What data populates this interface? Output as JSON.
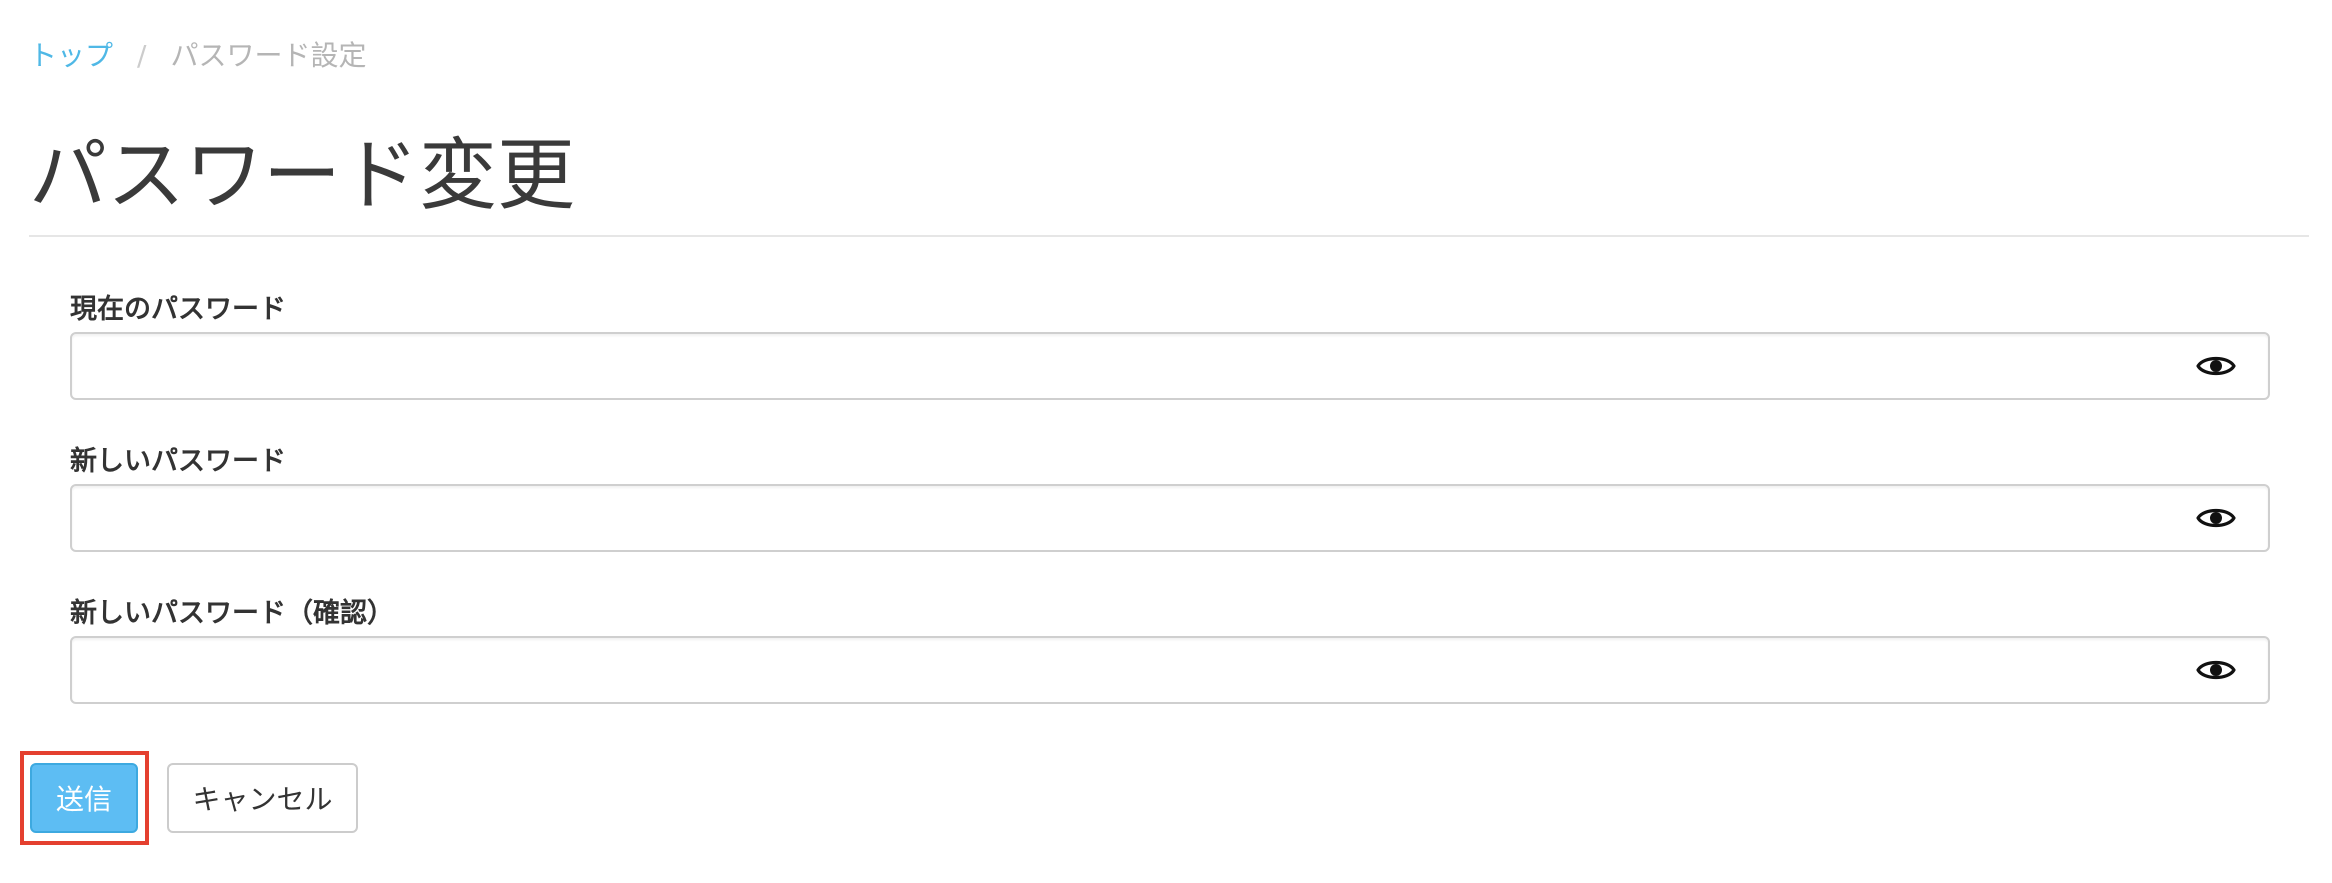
{
  "breadcrumb": {
    "items": [
      {
        "label": "トップ",
        "link": true
      },
      {
        "label": "パスワード設定",
        "link": false
      }
    ],
    "separator": "/"
  },
  "page": {
    "title": "パスワード変更"
  },
  "form": {
    "fields": [
      {
        "label": "現在のパスワード",
        "value": "",
        "icon": "eye-icon"
      },
      {
        "label": "新しいパスワード",
        "value": "",
        "icon": "eye-icon"
      },
      {
        "label": "新しいパスワード（確認）",
        "value": "",
        "icon": "eye-icon"
      }
    ],
    "submit_label": "送信",
    "cancel_label": "キャンセル"
  },
  "colors": {
    "link": "#4fb8e6",
    "submit_bg": "#5dbdf3",
    "highlight_border": "#e4402f"
  }
}
